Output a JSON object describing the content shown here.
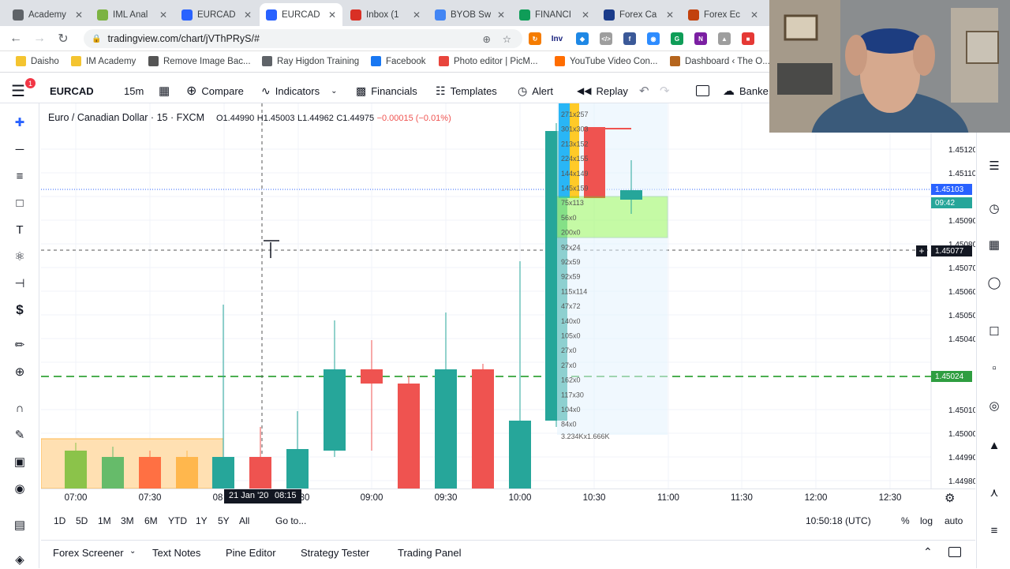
{
  "tabs": [
    {
      "title": "Academy",
      "color": "#5f6368",
      "icon": "globe-icon"
    },
    {
      "title": "IML Anal",
      "color": "#7cb342",
      "icon": "iml-icon"
    },
    {
      "title": "EURCAD",
      "color": "#2962ff",
      "icon": "tradingview-icon"
    },
    {
      "title": "EURCAD",
      "color": "#2962ff",
      "icon": "tradingview-icon"
    },
    {
      "title": "Inbox (1",
      "color": "#d93025",
      "icon": "gmail-icon"
    },
    {
      "title": "BYOB Sw",
      "color": "#4285f4",
      "icon": "docs-icon"
    },
    {
      "title": "FINANCI",
      "color": "#0f9d58",
      "icon": "sheets-icon"
    },
    {
      "title": "Forex Ca",
      "color": "#1a3b8a",
      "icon": "forex-calendar-icon"
    },
    {
      "title": "Forex Ec",
      "color": "#c2410c",
      "icon": "forex-eco-icon"
    }
  ],
  "url": "tradingview.com/chart/jVThPRyS/#",
  "bookmarks": [
    {
      "label": "Daisho",
      "icon": "folder-icon",
      "color": "#f4c430"
    },
    {
      "label": "IM Academy",
      "icon": "folder-icon",
      "color": "#f4c430"
    },
    {
      "label": "Remove Image Bac...",
      "icon": "removebg-icon",
      "color": "#555"
    },
    {
      "label": "Ray Higdon Training",
      "icon": "globe-icon",
      "color": "#5f6368"
    },
    {
      "label": "Facebook",
      "icon": "facebook-icon",
      "color": "#1877f2"
    },
    {
      "label": "Photo editor | PicM...",
      "icon": "picmonkey-icon",
      "color": "#e8453c"
    },
    {
      "label": "YouTube Video Con...",
      "icon": "converter-icon",
      "color": "#ff6d00"
    },
    {
      "label": "Dashboard ‹ The O...",
      "icon": "wordpress-icon",
      "color": "#b5651d"
    }
  ],
  "toolbar": {
    "symbol": "EURCAD",
    "interval": "15m",
    "compare": "Compare",
    "indicators": "Indicators",
    "financials": "Financials",
    "templates": "Templates",
    "alert": "Alert",
    "replay": "Replay",
    "broker": "Banke",
    "notification_count": "1"
  },
  "legend": {
    "title": "Euro / Canadian Dollar · 15 · FXCM",
    "open": "O1.44990",
    "high": "H1.45003",
    "low": "L1.44962",
    "close": "C1.44975",
    "change": "−0.00015 (−0.01%)"
  },
  "price_axis": [
    "1.45120",
    "1.45110",
    "1.45090",
    "1.45080",
    "1.45070",
    "1.45060",
    "1.45050",
    "1.45040",
    "1.45010",
    "1.45000",
    "1.44990",
    "1.44980"
  ],
  "price_badges": {
    "last": "1.45103",
    "countdown": "09:42",
    "cursor": "1.45077",
    "line": "1.45024"
  },
  "time_axis": [
    "07:00",
    "07:30",
    "08",
    "08:30",
    "09:00",
    "09:30",
    "10:00",
    "10:30",
    "11:00",
    "11:30",
    "12:00",
    "12:30"
  ],
  "cursor_date": "21 Jan '20",
  "cursor_time": "08:15",
  "profile_labels": [
    "271x257",
    "301x303",
    "213x152",
    "224x155",
    "144x149",
    "145x159",
    "75x113",
    "56x0",
    "200x0",
    "92x24",
    "92x59",
    "92x59",
    "115x114",
    "47x72",
    "140x0",
    "105x0",
    "27x0",
    "27x0",
    "162x0",
    "117x30",
    "104x0",
    "84x0"
  ],
  "profile_total": "3.234Kx1.666K",
  "ranges": [
    "1D",
    "5D",
    "1M",
    "3M",
    "6M",
    "YTD",
    "1Y",
    "5Y",
    "All"
  ],
  "goto": "Go to...",
  "clock": "10:50:18 (UTC)",
  "scale_opts": [
    "%",
    "log",
    "auto"
  ],
  "bottom_tabs": [
    "Forex Screener",
    "Text Notes",
    "Pine Editor",
    "Strategy Tester",
    "Trading Panel"
  ],
  "colors": {
    "up": "#26a69a",
    "down": "#ef5350",
    "accent": "#2962ff"
  }
}
